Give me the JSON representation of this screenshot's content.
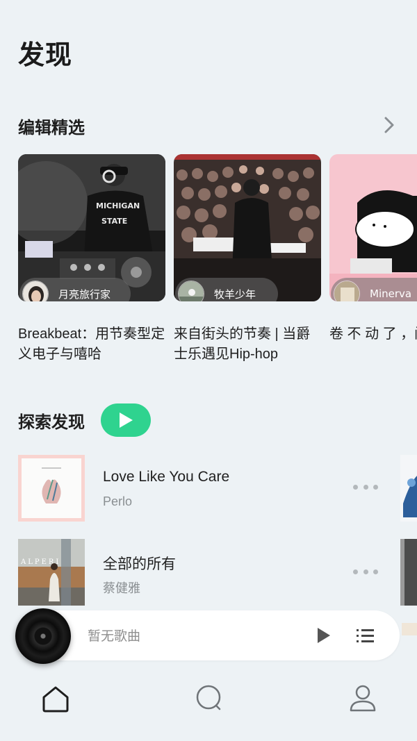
{
  "page": {
    "title": "发现"
  },
  "editor_picks": {
    "title": "编辑精选",
    "cards": [
      {
        "curator": "月亮旅行家",
        "caption": "Breakbeat：用节奏型定义电子与嘻哈",
        "image": "dj-michigan-state-photo"
      },
      {
        "curator": "牧羊少年",
        "caption": "来自街头的节奏 | 当爵士乐遇见Hip-hop",
        "image": "jazz-concert-crowd-photo"
      },
      {
        "curator": "Minerva",
        "caption": "卷 不 动 了 ，闲 置",
        "image": "cartoon-lying-figure-illustration"
      }
    ]
  },
  "explore": {
    "title": "探索发现",
    "songs": [
      {
        "title": "Love Like You Care",
        "artist": "Perlo"
      },
      {
        "title": "全部的所有",
        "artist": "蔡健雅"
      }
    ]
  },
  "player": {
    "status_text": "暂无歌曲"
  },
  "tabs": [
    "home-icon",
    "search-icon",
    "profile-icon"
  ],
  "colors": {
    "accent": "#2fd38f",
    "background": "#edf2f5"
  }
}
